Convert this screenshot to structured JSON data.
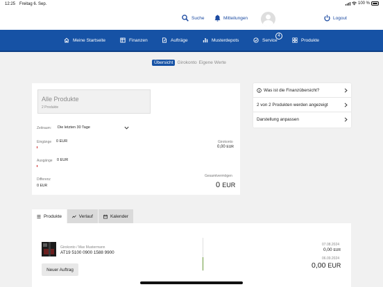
{
  "status_bar": {
    "time": "12:25",
    "date": "Freitag 6. Sep.",
    "battery": "100 %"
  },
  "header": {
    "search_label": "Suche",
    "messages_label": "Mitteilungen",
    "logout_label": "Logout"
  },
  "nav": {
    "items": [
      {
        "label": "Meine Startseite",
        "icon": "home-icon"
      },
      {
        "label": "Finanzen",
        "icon": "finance-icon"
      },
      {
        "label": "Aufträge",
        "icon": "orders-icon"
      },
      {
        "label": "Musterdepots",
        "icon": "chart-bars-icon"
      },
      {
        "label": "Service",
        "icon": "service-check-icon",
        "badge": "4"
      },
      {
        "label": "Produkte",
        "icon": "grid-icon"
      }
    ]
  },
  "segments": {
    "items": [
      "Übersicht",
      "Girokonto",
      "Eigene Werte"
    ],
    "active_index": 0
  },
  "overview": {
    "title": "Alle Produkte",
    "subtitle": "2 Produkte",
    "period_label": "Zeitraum:",
    "period_value": "Die letzten 30 Tage",
    "income_label": "Eingänge",
    "income_value": "0 EUR",
    "expense_label": "Ausgänge",
    "expense_value": "0 EUR",
    "difference_label": "Differenz",
    "difference_value": "0",
    "difference_unit": "EUR",
    "giro_label": "Girokonto",
    "giro_value": "0,00",
    "giro_unit": "EUR",
    "total_label": "Gesamtvermögen",
    "total_value": "0",
    "total_unit": "EUR"
  },
  "side_menu": {
    "items": [
      "Was ist die Finanzübersicht?",
      "2 von 2 Produkten werden angezeigt",
      "Darstellung anpassen"
    ]
  },
  "bottom_tabs": {
    "items": [
      "Produkte",
      "Verlauf",
      "Kalender"
    ],
    "active_index": 0
  },
  "product": {
    "account_label": "Girokonto / Max Mustermann",
    "iban": "AT19 5100 0900 1588 9900",
    "new_order_label": "Neuer Auftrag",
    "date1": "07.08.2024",
    "value1": "0,00",
    "unit1": "EUR",
    "date2": "06.09.2024",
    "value2": "0,00",
    "unit2": "EUR"
  },
  "colors": {
    "brand_blue": "#1652a5",
    "accent_green": "#6a9a3a",
    "negative_red": "#d12b2b"
  }
}
